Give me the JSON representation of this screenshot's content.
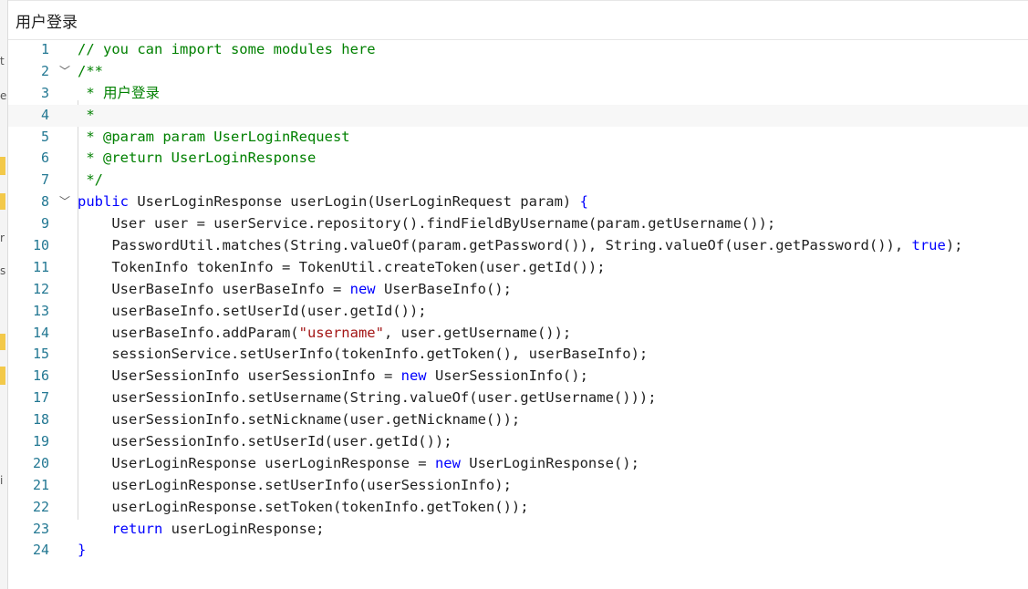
{
  "dialog": {
    "title": "用户登录"
  },
  "editor": {
    "lines": [
      {
        "num": "1",
        "fold": "",
        "code": [
          {
            "t": "// you can import some modules here",
            "c": "comment"
          }
        ]
      },
      {
        "num": "2",
        "fold": "﹀",
        "code": [
          {
            "t": "/**",
            "c": "comment"
          }
        ]
      },
      {
        "num": "3",
        "fold": "",
        "code": [
          {
            "t": " * 用户登录",
            "c": "comment"
          }
        ]
      },
      {
        "num": "4",
        "fold": "",
        "code": [
          {
            "t": " *",
            "c": "comment"
          }
        ]
      },
      {
        "num": "5",
        "fold": "",
        "code": [
          {
            "t": " * @param param UserLoginRequest",
            "c": "comment"
          }
        ]
      },
      {
        "num": "6",
        "fold": "",
        "code": [
          {
            "t": " * @return UserLoginResponse",
            "c": "comment"
          }
        ]
      },
      {
        "num": "7",
        "fold": "",
        "code": [
          {
            "t": " */",
            "c": "comment"
          }
        ]
      },
      {
        "num": "8",
        "fold": "﹀",
        "code": [
          {
            "t": "public",
            "c": "kw"
          },
          {
            "t": " UserLoginResponse userLogin(UserLoginRequest param) ",
            "c": ""
          },
          {
            "t": "{",
            "c": "kw"
          }
        ]
      },
      {
        "num": "9",
        "fold": "",
        "code": [
          {
            "t": "    User user = userService.repository().findFieldByUsername(param.getUsername());",
            "c": ""
          }
        ]
      },
      {
        "num": "10",
        "fold": "",
        "code": [
          {
            "t": "    PasswordUtil.matches(String.valueOf(param.getPassword()), String.valueOf(user.getPassword()), ",
            "c": ""
          },
          {
            "t": "true",
            "c": "kw"
          },
          {
            "t": ");",
            "c": ""
          }
        ]
      },
      {
        "num": "11",
        "fold": "",
        "code": [
          {
            "t": "    TokenInfo tokenInfo = TokenUtil.createToken(user.getId());",
            "c": ""
          }
        ]
      },
      {
        "num": "12",
        "fold": "",
        "code": [
          {
            "t": "    UserBaseInfo userBaseInfo = ",
            "c": ""
          },
          {
            "t": "new",
            "c": "kw"
          },
          {
            "t": " UserBaseInfo();",
            "c": ""
          }
        ]
      },
      {
        "num": "13",
        "fold": "",
        "code": [
          {
            "t": "    userBaseInfo.setUserId(user.getId());",
            "c": ""
          }
        ]
      },
      {
        "num": "14",
        "fold": "",
        "code": [
          {
            "t": "    userBaseInfo.addParam(",
            "c": ""
          },
          {
            "t": "\"username\"",
            "c": "str"
          },
          {
            "t": ", user.getUsername());",
            "c": ""
          }
        ]
      },
      {
        "num": "15",
        "fold": "",
        "code": [
          {
            "t": "    sessionService.setUserInfo(tokenInfo.getToken(), userBaseInfo);",
            "c": ""
          }
        ]
      },
      {
        "num": "16",
        "fold": "",
        "code": [
          {
            "t": "    UserSessionInfo userSessionInfo = ",
            "c": ""
          },
          {
            "t": "new",
            "c": "kw"
          },
          {
            "t": " UserSessionInfo();",
            "c": ""
          }
        ]
      },
      {
        "num": "17",
        "fold": "",
        "code": [
          {
            "t": "    userSessionInfo.setUsername(String.valueOf(user.getUsername()));",
            "c": ""
          }
        ]
      },
      {
        "num": "18",
        "fold": "",
        "code": [
          {
            "t": "    userSessionInfo.setNickname(user.getNickname());",
            "c": ""
          }
        ]
      },
      {
        "num": "19",
        "fold": "",
        "code": [
          {
            "t": "    userSessionInfo.setUserId(user.getId());",
            "c": ""
          }
        ]
      },
      {
        "num": "20",
        "fold": "",
        "code": [
          {
            "t": "    UserLoginResponse userLoginResponse = ",
            "c": ""
          },
          {
            "t": "new",
            "c": "kw"
          },
          {
            "t": " UserLoginResponse();",
            "c": ""
          }
        ]
      },
      {
        "num": "21",
        "fold": "",
        "code": [
          {
            "t": "    userLoginResponse.setUserInfo(userSessionInfo);",
            "c": ""
          }
        ]
      },
      {
        "num": "22",
        "fold": "",
        "code": [
          {
            "t": "    userLoginResponse.setToken(tokenInfo.getToken());",
            "c": ""
          }
        ]
      },
      {
        "num": "23",
        "fold": "",
        "code": [
          {
            "t": "    ",
            "c": ""
          },
          {
            "t": "return",
            "c": "kw"
          },
          {
            "t": " userLoginResponse;",
            "c": ""
          }
        ]
      },
      {
        "num": "24",
        "fold": "",
        "code": [
          {
            "t": "}",
            "c": "kw"
          }
        ]
      }
    ],
    "current_line": 4
  },
  "background_fragments": [
    "t",
    "e",
    "r",
    "s",
    "i"
  ],
  "colors": {
    "comment": "#008000",
    "keyword": "#0000ff",
    "string": "#a31515",
    "line_number": "#237893"
  }
}
